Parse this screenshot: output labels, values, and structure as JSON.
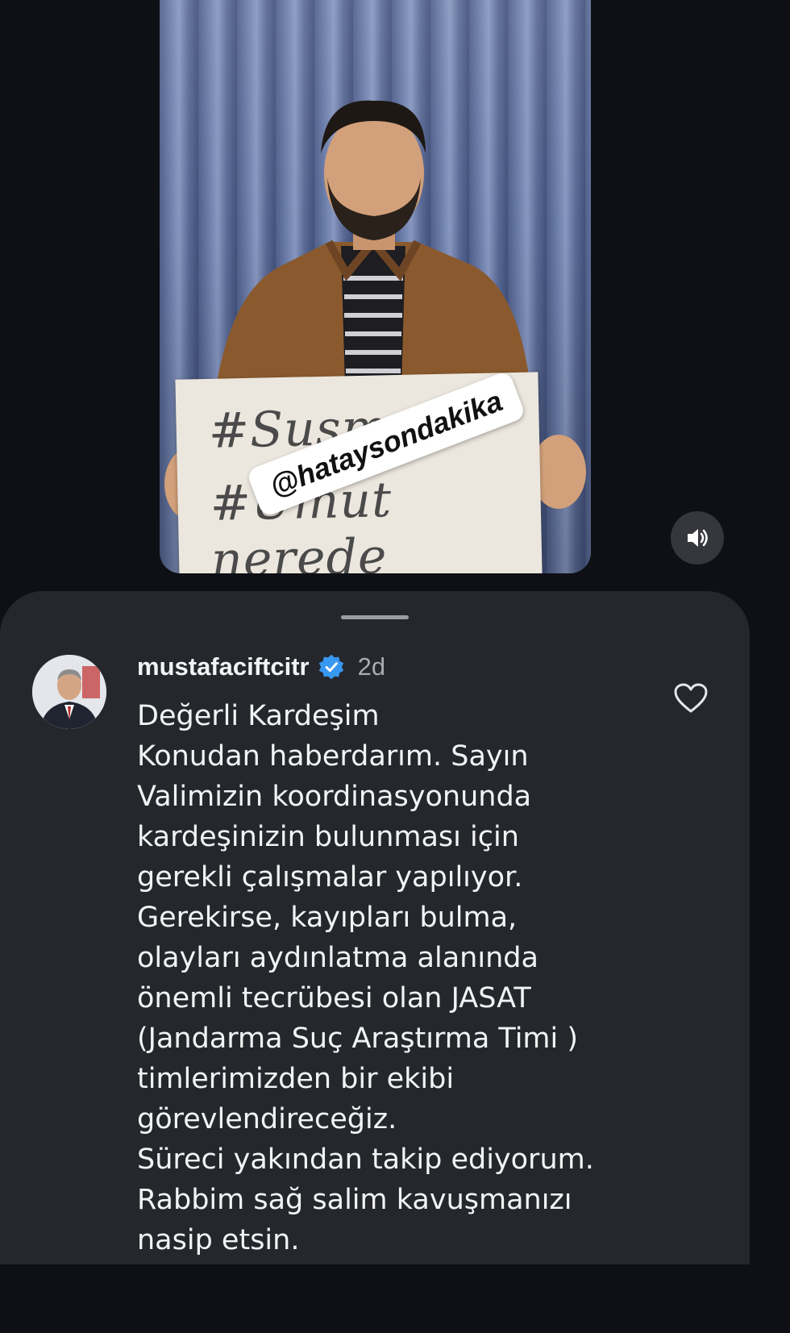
{
  "video": {
    "sign_text_line1": "#Susma",
    "sign_text_line2": "#Umut nerede",
    "watermark": "@hataysondakika",
    "sound_icon": "speaker-on-icon"
  },
  "comment": {
    "username": "mustafaciftcitr",
    "verified_icon": "verified-badge-icon",
    "time": "2d",
    "like_icon": "heart-outline-icon",
    "lines": [
      "Değerli Kardeşim",
      "Konudan haberdarım. Sayın",
      "Valimizin koordinasyonunda",
      "kardeşinizin bulunması için",
      "gerekli çalışmalar yapılıyor.",
      "Gerekirse, kayıpları bulma,",
      "olayları aydınlatma alanında",
      "önemli tecrübesi olan JASAT",
      "(Jandarma Suç Araştırma Timi )",
      "timlerimizden bir ekibi",
      "görevlendireceğiz.",
      "Süreci yakından takip ediyorum.",
      "Rabbim sağ salim kavuşmanızı",
      "nasip etsin."
    ]
  },
  "colors": {
    "background": "#0e1015",
    "sheet": "#25272c",
    "verified": "#3897f0",
    "text_primary": "#f2f3f5",
    "text_secondary": "#a8abb1"
  }
}
